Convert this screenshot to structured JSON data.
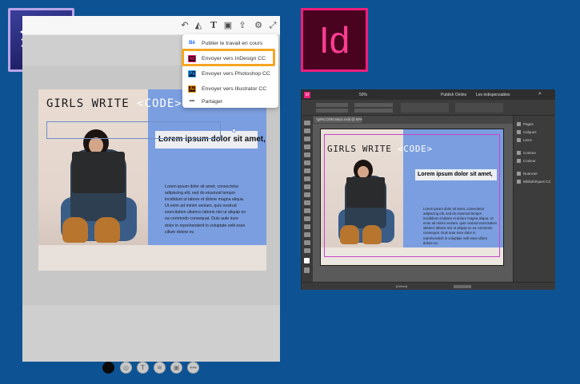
{
  "document": {
    "title_left": "GIRLS WRITE",
    "title_right": "<CODE>",
    "heading_box": "Lorem ipsum dolor sit amet,",
    "body_text": "Lorem ipsum dolor sit amet, consectetur adipiscing elit, sed do eiusmod tempor incididunt ut labore et dolore magna aliqua. Ut enim ad minim veniam, quis nostrud exercitation ullamco laboris nisi ut aliquip ex ea commodo consequat. Duis aute irure dolor in reprehenderit in voluptate velit esse cillum dolore eu"
  },
  "share_menu": {
    "items": [
      {
        "icon": "Bē",
        "icon_name": "behance-icon",
        "label": "Publier le travail en cours",
        "color": "#1769ff"
      },
      {
        "icon": "Id",
        "icon_name": "indesign-icon",
        "label": "Envoyer vers InDesign CC",
        "color": "#ed1f7b"
      },
      {
        "icon": "Ps",
        "icon_name": "photoshop-icon",
        "label": "Envoyer vers Photoshop CC",
        "color": "#31a8ff"
      },
      {
        "icon": "Ai",
        "icon_name": "illustrator-icon",
        "label": "Envoyer vers Illustrator CC",
        "color": "#ff9a00"
      },
      {
        "icon": "•••",
        "icon_name": "more-dots-icon",
        "label": "Partager",
        "color": "#333333"
      }
    ],
    "highlight_color": "#f4a623"
  },
  "logos": {
    "indesign": "Id"
  },
  "indesign_window": {
    "zoom": "50%",
    "publish_button": "Publish Online",
    "workspace": "Les indispensables",
    "doc_tab": "*girlsCODE1step1.indd @ 50%",
    "panels": [
      "Pages",
      "Calques",
      "Liens",
      "Contour",
      "Couleur",
      "Nuancier",
      "Bibliothèques CC"
    ],
    "status_text": "[Défaut]"
  },
  "colors": {
    "background": "#0d5393",
    "panel_blue": "#7b9ee0",
    "indesign_pink": "#ed1f7b"
  }
}
